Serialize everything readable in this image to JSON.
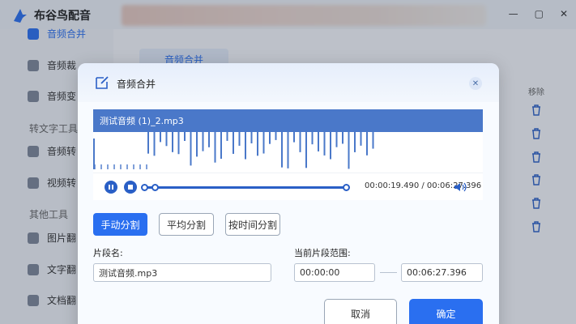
{
  "app": {
    "name": "布谷鸟配音",
    "window_controls": [
      "—",
      "▢",
      "✕"
    ],
    "sidebar": {
      "items": [
        {
          "label": "音频合并",
          "icon": "merge-icon",
          "active": true
        },
        {
          "label": "音频裁"
        },
        {
          "label": "音频变"
        }
      ],
      "group1": "转文字工具",
      "items2": [
        {
          "label": "音频转"
        },
        {
          "label": "视频转"
        }
      ],
      "group2": "其他工具",
      "items3": [
        {
          "label": "图片翻"
        },
        {
          "label": "文字翻"
        },
        {
          "label": "文档翻"
        }
      ]
    },
    "bg_tab": "音频合并",
    "col_remove": "移除"
  },
  "dialog": {
    "title": "音频合并",
    "close_icon": "close-icon",
    "file_name": "测试音频 (1)_2.mp3",
    "player": {
      "time": "00:00:19.490 / 00:06:27.396",
      "progress_fraction": 0.05
    },
    "split_buttons": {
      "manual": "手动分割",
      "average": "平均分割",
      "by_time": "按时间分割"
    },
    "segment_name_label": "片段名:",
    "segment_name_value": "测试音频.mp3",
    "range_label": "当前片段范围:",
    "range_start": "00:00:00",
    "range_end": "00:06:27.396",
    "cancel": "取消",
    "confirm": "确定"
  },
  "colors": {
    "accent": "#2a6ff0",
    "file_bar": "#4a78c9",
    "wave": "#4a78c9"
  }
}
